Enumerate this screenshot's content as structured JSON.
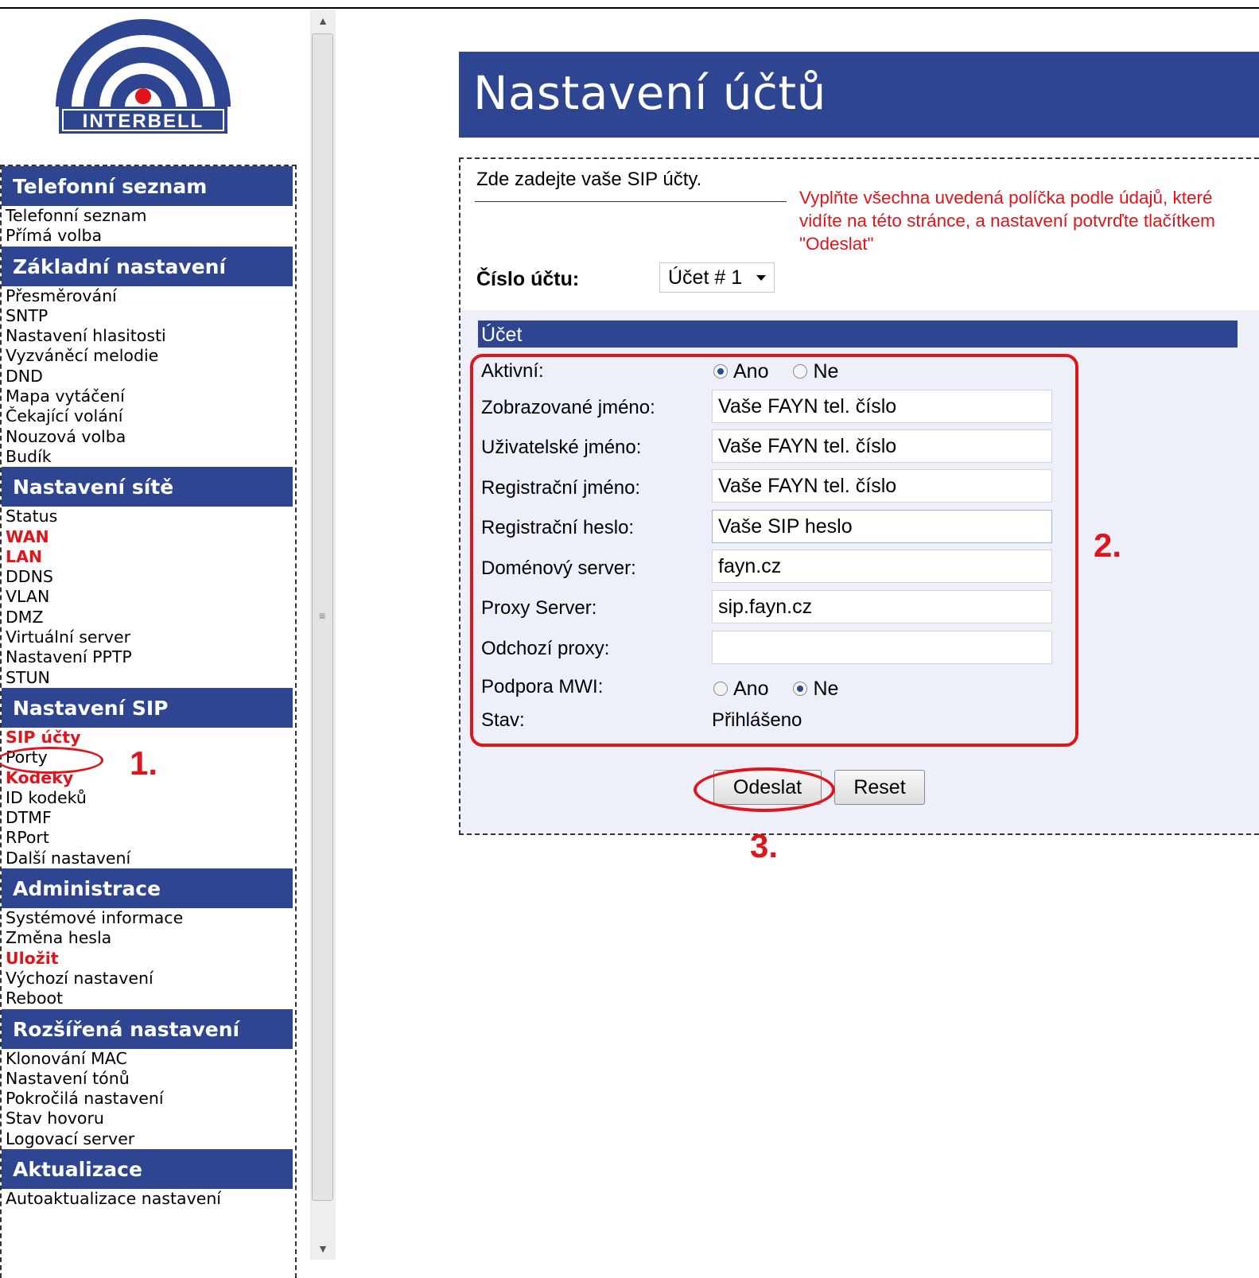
{
  "logo": {
    "text": "INTERBELL"
  },
  "nav": [
    {
      "title": "Telefonní seznam",
      "items": [
        {
          "label": "Telefonní seznam"
        },
        {
          "label": "Přímá volba"
        }
      ]
    },
    {
      "title": "Základní nastavení",
      "items": [
        {
          "label": "Přesměrování"
        },
        {
          "label": "SNTP"
        },
        {
          "label": "Nastavení hlasitosti"
        },
        {
          "label": "Vyzváněcí melodie"
        },
        {
          "label": "DND"
        },
        {
          "label": "Mapa vytáčení"
        },
        {
          "label": "Čekající volání"
        },
        {
          "label": "Nouzová volba"
        },
        {
          "label": "Budík"
        }
      ]
    },
    {
      "title": "Nastavení sítě",
      "items": [
        {
          "label": "Status"
        },
        {
          "label": "WAN",
          "red": true
        },
        {
          "label": "LAN",
          "red": true
        },
        {
          "label": "DDNS"
        },
        {
          "label": "VLAN"
        },
        {
          "label": "DMZ"
        },
        {
          "label": "Virtuální server"
        },
        {
          "label": "Nastavení PPTP"
        },
        {
          "label": "STUN"
        }
      ]
    },
    {
      "title": "Nastavení SIP",
      "items": [
        {
          "label": "SIP účty",
          "red": true
        },
        {
          "label": "Porty"
        },
        {
          "label": "Kodeky",
          "red": true
        },
        {
          "label": "ID kodeků"
        },
        {
          "label": "DTMF"
        },
        {
          "label": "RPort"
        },
        {
          "label": "Další nastavení"
        }
      ]
    },
    {
      "title": "Administrace",
      "items": [
        {
          "label": "Systémové informace"
        },
        {
          "label": "Změna hesla"
        },
        {
          "label": "Uložit",
          "red": true
        },
        {
          "label": "Výchozí nastavení"
        },
        {
          "label": "Reboot"
        }
      ]
    },
    {
      "title": "Rozšířená nastavení",
      "items": [
        {
          "label": "Klonování MAC"
        },
        {
          "label": "Nastavení tónů"
        },
        {
          "label": "Pokročilá nastavení"
        },
        {
          "label": "Stav hovoru"
        },
        {
          "label": "Logovací server"
        }
      ]
    },
    {
      "title": "Aktualizace",
      "items": [
        {
          "label": "Autoaktualizace nastavení"
        }
      ]
    }
  ],
  "page_title": "Nastavení účtů",
  "intro": "Zde zadejte vaše SIP účty.",
  "note": "Vyplňte všechna uvedená políčka podle údajů, které vidíte na této stránce, a nastavení potvrďte tlačítkem \"Odeslat\"",
  "account_select": {
    "label": "Číslo účtu:",
    "value": "Účet # 1"
  },
  "section_title": "Účet",
  "fields": {
    "active": {
      "label": "Aktivní:",
      "yes": "Ano",
      "no": "Ne",
      "selected": "yes"
    },
    "display_name": {
      "label": "Zobrazované jméno:",
      "value": "Vaše FAYN tel. číslo"
    },
    "user_name": {
      "label": "Uživatelské jméno:",
      "value": "Vaše FAYN tel. číslo"
    },
    "reg_name": {
      "label": "Registrační jméno:",
      "value": "Vaše FAYN tel. číslo"
    },
    "reg_password": {
      "label": "Registrační heslo:",
      "value": "Vaše SIP heslo"
    },
    "domain_server": {
      "label": "Doménový server:",
      "value": "fayn.cz"
    },
    "proxy_server": {
      "label": "Proxy Server:",
      "value": "sip.fayn.cz"
    },
    "outbound_proxy": {
      "label": "Odchozí proxy:",
      "value": ""
    },
    "mwi": {
      "label": "Podpora MWI:",
      "yes": "Ano",
      "no": "Ne",
      "selected": "no"
    },
    "status": {
      "label": "Stav:",
      "value": "Přihlášeno"
    }
  },
  "buttons": {
    "submit": "Odeslat",
    "reset": "Reset"
  },
  "annotations": {
    "step1": "1.",
    "step2": "2.",
    "step3": "3."
  },
  "colors": {
    "header_blue": "#2e4592",
    "highlight_red": "#e0141b"
  }
}
